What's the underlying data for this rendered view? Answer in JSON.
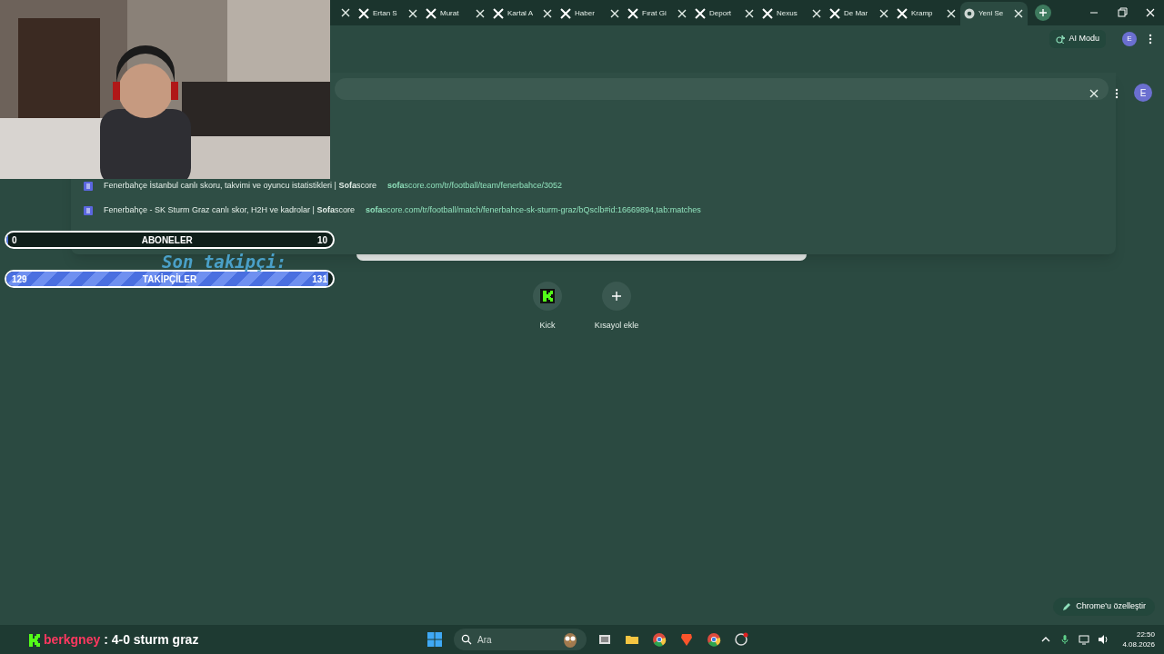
{
  "tabs": [
    {
      "title": "Ertan S",
      "kind": "x",
      "selected": false
    },
    {
      "title": "Murat",
      "kind": "x",
      "selected": false
    },
    {
      "title": "Kartal A",
      "kind": "x",
      "selected": false
    },
    {
      "title": "Haber",
      "kind": "x",
      "selected": false
    },
    {
      "title": "Fırat Gi",
      "kind": "x",
      "selected": false
    },
    {
      "title": "Deport",
      "kind": "x",
      "selected": false
    },
    {
      "title": "Nexus",
      "kind": "x",
      "selected": false
    },
    {
      "title": "De Mar",
      "kind": "x",
      "selected": false
    },
    {
      "title": "Kramp",
      "kind": "x",
      "selected": false
    },
    {
      "title": "Yeni Se",
      "kind": "chrome",
      "selected": true
    }
  ],
  "toolbar": {
    "ai_mode": "AI Modu",
    "profile_initial": "E"
  },
  "omnibox": {
    "profile_initial": "E",
    "suggestions": [
      {
        "title": "Fenerbahçe İstanbul canlı skoru, takvimi ve oyuncu istatistikleri | **Sofa**score",
        "url": "**sofa**score.com/tr/football/team/fenerbahce/3052"
      },
      {
        "title": "Fenerbahçe - SK Sturm Graz canlı skor, H2H ve kadrolar | **Sofa**score",
        "url": "**sofa**score.com/tr/football/match/fenerbahce-sk-sturm-graz/bQsclb#id:16669894,tab:matches"
      }
    ]
  },
  "shortcuts": [
    {
      "label": "Kick",
      "kind": "kick"
    },
    {
      "label": "Kısayol ekle",
      "kind": "add"
    }
  ],
  "customize_button": "Chrome'u özelleştir",
  "stream_overlay": {
    "goals": [
      {
        "label": "ABONELER",
        "current": "0",
        "target": "10",
        "level": 0,
        "kind": "plain"
      },
      {
        "label": "TAKİPÇİLER",
        "current": "129",
        "target": "131",
        "level": 0.985,
        "kind": "striped"
      }
    ],
    "last_follower_label": "Son takipçi:",
    "chat": {
      "user": "berkgney",
      "message": ": 4-0 sturm graz"
    }
  },
  "taskbar": {
    "search_placeholder": "Ara",
    "time": "22:50",
    "date": "4.08.2026"
  }
}
